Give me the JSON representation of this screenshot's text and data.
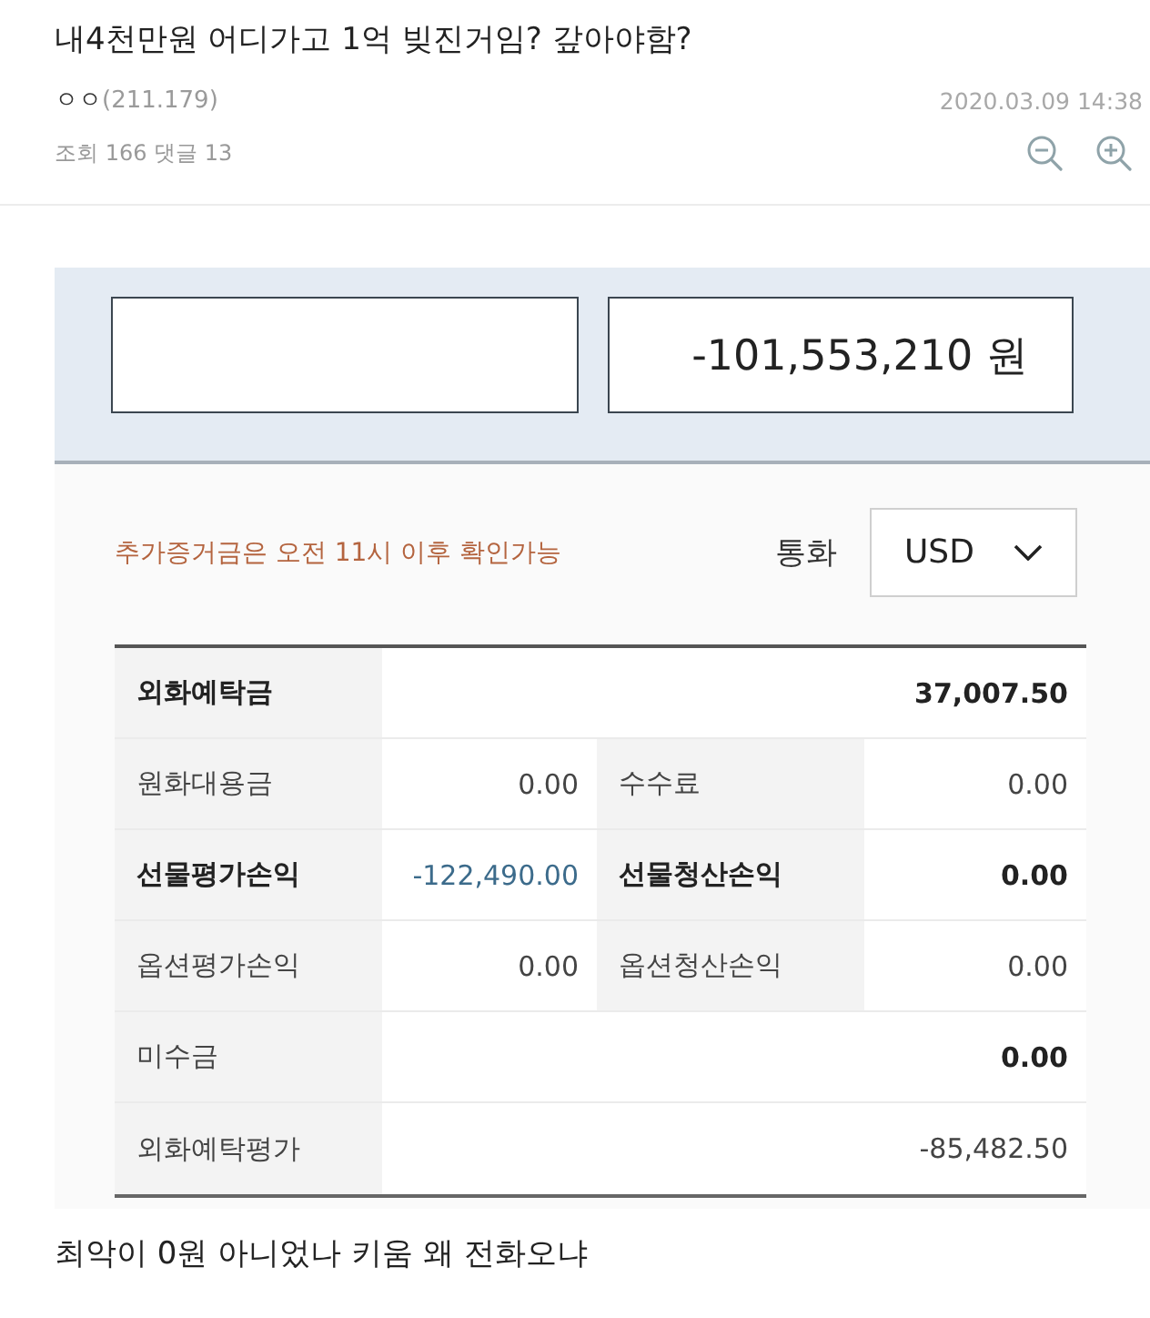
{
  "post": {
    "title": "내4천만원 어디가고 1억 빚진거임? 갚아야함?",
    "author": "ㅇㅇ",
    "ip": "(211.179)",
    "date": "2020.03.09 14:38",
    "stats": "조회 166 댓글 13"
  },
  "summary": {
    "value": "-101,553,210 원"
  },
  "notice": "추가증거금은 오전 11시 이후 확인가능",
  "currency": {
    "label": "통화",
    "value": "USD"
  },
  "balances": {
    "rows": [
      {
        "cells": [
          {
            "label": "외화예탁금",
            "label_bold": true,
            "value": "37,007.50",
            "value_bold": true,
            "highlighted": false
          }
        ]
      },
      {
        "cells": [
          {
            "label": "원화대용금",
            "label_bold": false,
            "value": "0.00",
            "value_bold": false,
            "highlighted": false
          },
          {
            "label": "수수료",
            "label_bold": false,
            "value": "0.00",
            "value_bold": false,
            "highlighted": false
          }
        ]
      },
      {
        "cells": [
          {
            "label": "선물평가손익",
            "label_bold": true,
            "value": "-122,490.00",
            "value_bold": false,
            "highlighted": true
          },
          {
            "label": "선물청산손익",
            "label_bold": true,
            "value": "0.00",
            "value_bold": true,
            "highlighted": false
          }
        ]
      },
      {
        "cells": [
          {
            "label": "옵션평가손익",
            "label_bold": false,
            "value": "0.00",
            "value_bold": false,
            "highlighted": false
          },
          {
            "label": "옵션청산손익",
            "label_bold": false,
            "value": "0.00",
            "value_bold": false,
            "highlighted": false
          }
        ]
      },
      {
        "cells": [
          {
            "label": "미수금",
            "label_bold": false,
            "value": "0.00",
            "value_bold": true,
            "highlighted": false
          }
        ]
      },
      {
        "cells": [
          {
            "label": "외화예탁평가",
            "label_bold": false,
            "value": "-85,482.50",
            "value_bold": false,
            "highlighted": false
          }
        ]
      }
    ]
  },
  "comment": "최악이 0원 아니었나 키움 왜 전화오냐"
}
